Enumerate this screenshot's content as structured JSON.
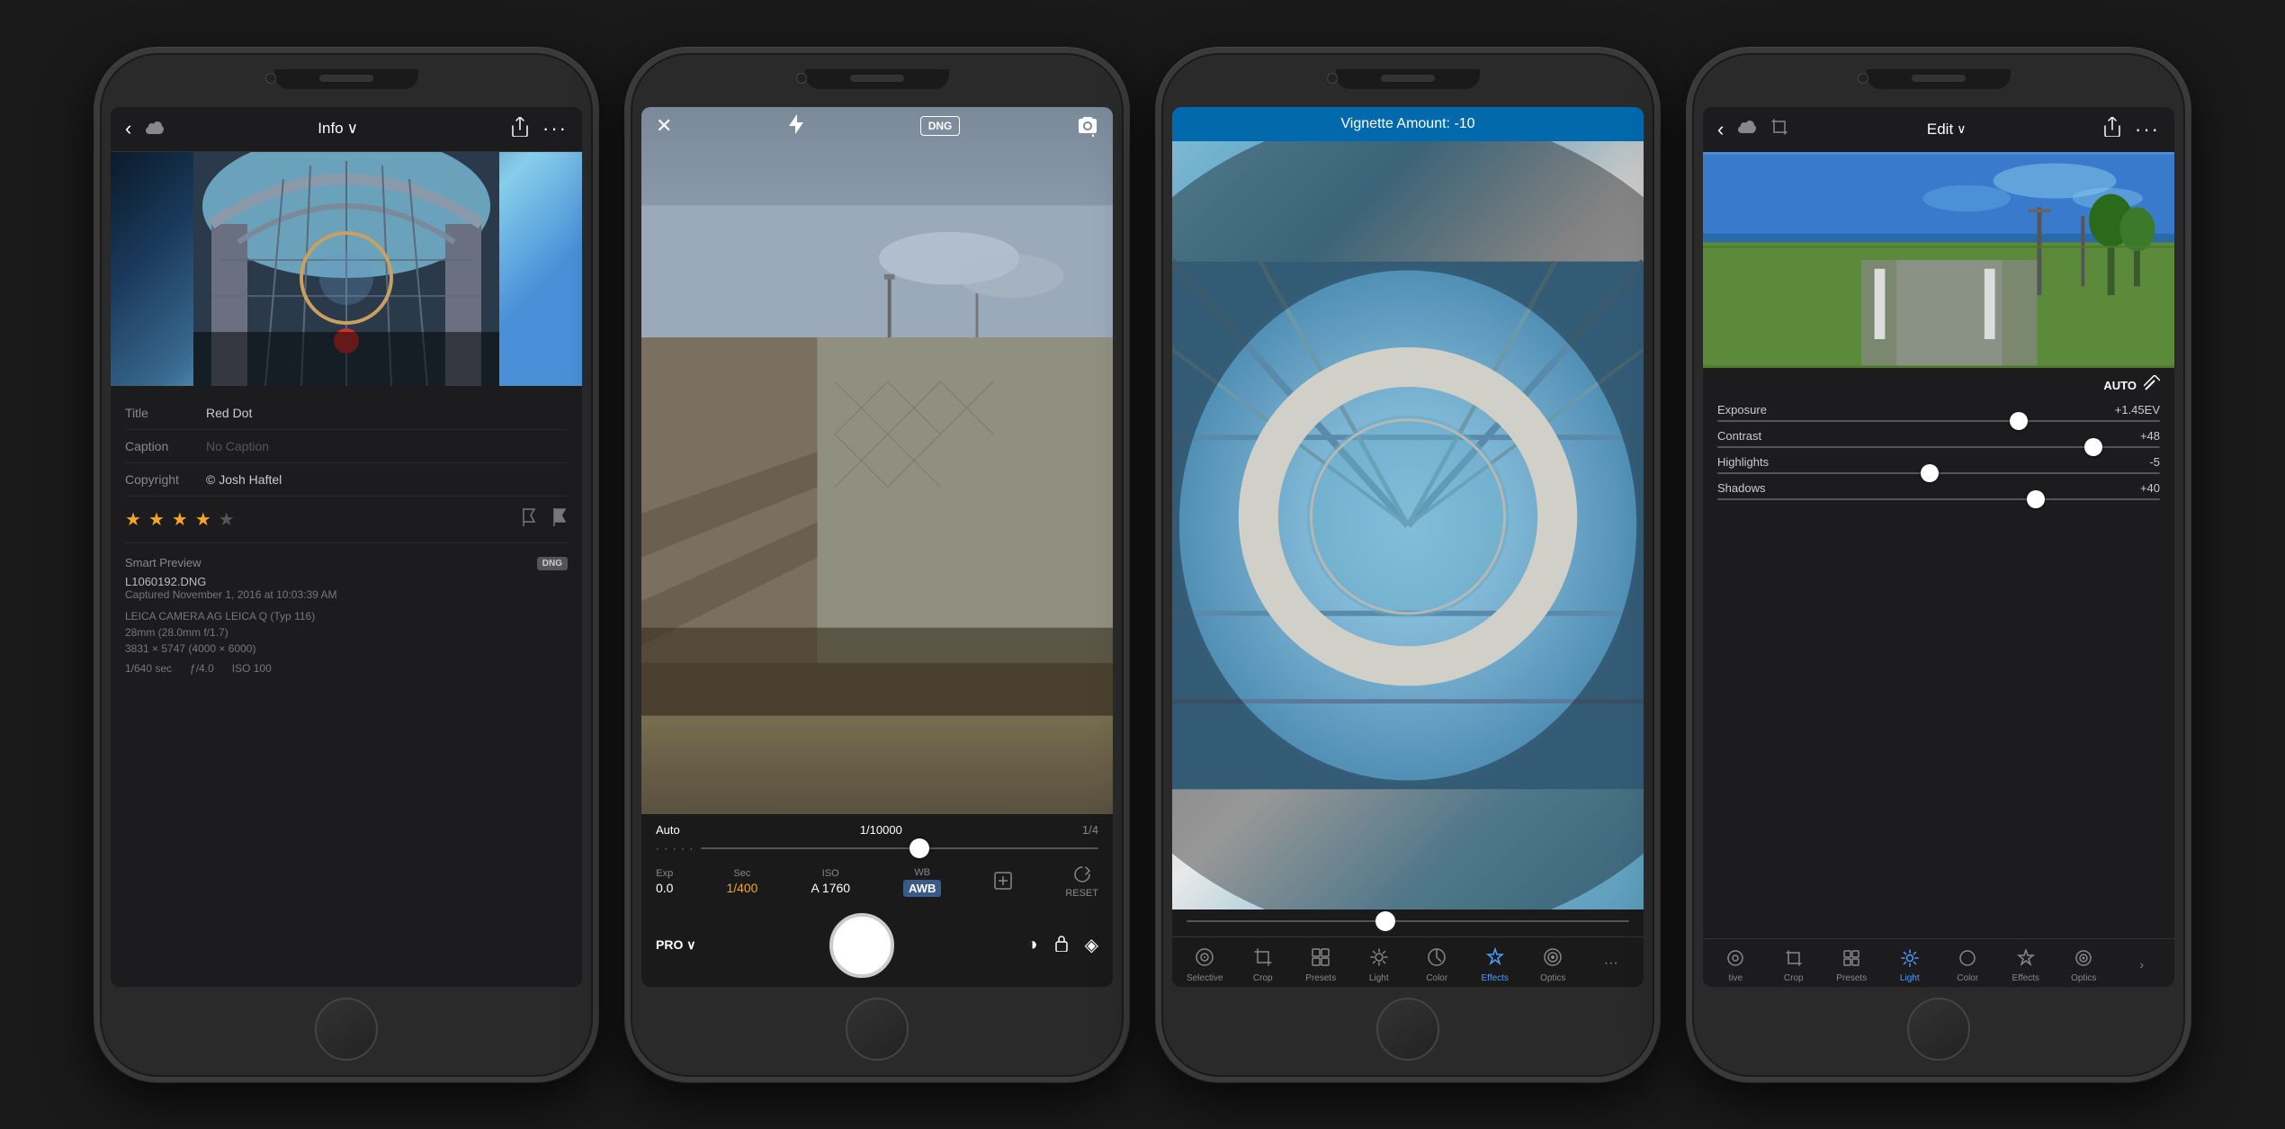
{
  "phones": [
    {
      "id": "phone1",
      "screen": "info",
      "header": {
        "back_label": "‹",
        "cloud_icon": "☁",
        "title": "Info",
        "dropdown_arrow": "∨",
        "share_icon": "⬆",
        "more_icon": "···"
      },
      "metadata": {
        "title_label": "Title",
        "title_value": "Red Dot",
        "caption_label": "Caption",
        "caption_placeholder": "No Caption",
        "copyright_label": "Copyright",
        "copyright_value": "© Josh Haftel",
        "stars": 4,
        "star_total": 5
      },
      "file_info": {
        "preview_label": "Smart Preview",
        "dng_badge": "DNG",
        "filename": "L1060192.DNG",
        "captured": "Captured November 1, 2016 at 10:03:39 AM",
        "camera": "LEICA CAMERA AG LEICA Q (Typ 116)",
        "focal": "28mm (28.0mm f/1.7)",
        "dimensions": "3831 × 5747 (4000 × 6000)",
        "shutter": "1/640 sec",
        "aperture": "ƒ/4.0",
        "iso": "ISO 100"
      }
    },
    {
      "id": "phone2",
      "screen": "camera",
      "top_bar": {
        "close_icon": "✕",
        "lightning_icon": "⚡",
        "dng_badge": "DNG",
        "flip_icon": "⟳"
      },
      "exposure": {
        "label": "Auto",
        "value": "1/10000",
        "counter": "1/4"
      },
      "controls": [
        {
          "label": "Exp",
          "value": "0.0",
          "active": false
        },
        {
          "label": "Sec",
          "value": "1/400",
          "active": true
        },
        {
          "label": "ISO",
          "value": "A 1760",
          "active": false
        },
        {
          "label": "WB",
          "value": "AWB",
          "active": false
        },
        {
          "label": "[+]",
          "value": "",
          "active": false
        },
        {
          "label": "RESET",
          "value": "",
          "active": false
        }
      ],
      "pro_label": "PRO ∨",
      "right_icons": [
        "half-moon",
        "lock",
        "leaf"
      ]
    },
    {
      "id": "phone3",
      "screen": "effects",
      "vignette_header": "Vignette Amount: -10",
      "toolbar": [
        {
          "icon": "◎",
          "label": "Selective",
          "active": false
        },
        {
          "icon": "⊡",
          "label": "Crop",
          "active": false
        },
        {
          "icon": "▦",
          "label": "Presets",
          "active": false
        },
        {
          "icon": "☀",
          "label": "Light",
          "active": false
        },
        {
          "icon": "◐",
          "label": "Color",
          "active": false
        },
        {
          "icon": "✦",
          "label": "Effects",
          "active": true
        },
        {
          "icon": "◉",
          "label": "Optics",
          "active": false
        },
        {
          "icon": "···",
          "label": "",
          "active": false
        }
      ]
    },
    {
      "id": "phone4",
      "screen": "edit_light",
      "header": {
        "back_icon": "‹",
        "cloud_icon": "☁",
        "crop_icon": "⊡",
        "title": "Edit",
        "dropdown_arrow": "∨",
        "share_icon": "⬆",
        "more_icon": "···"
      },
      "auto_btn": "AUTO",
      "sliders": [
        {
          "name": "Exposure",
          "value": "+1.45EV",
          "thumb_pct": 68
        },
        {
          "name": "Contrast",
          "value": "+48",
          "thumb_pct": 85
        },
        {
          "name": "Highlights",
          "value": "-5",
          "thumb_pct": 48
        },
        {
          "name": "Shadows",
          "value": "+40",
          "thumb_pct": 72
        }
      ],
      "toolbar": [
        {
          "icon": "◎",
          "label": "tive",
          "active": false
        },
        {
          "icon": "⊡",
          "label": "Crop",
          "active": false
        },
        {
          "icon": "▦",
          "label": "Presets",
          "active": false
        },
        {
          "icon": "☀",
          "label": "Light",
          "active": true
        },
        {
          "icon": "◐",
          "label": "Color",
          "active": false
        },
        {
          "icon": "✦",
          "label": "Effects",
          "active": false
        },
        {
          "icon": "◉",
          "label": "Optics",
          "active": false
        },
        {
          "icon": ">",
          "label": "",
          "active": false
        }
      ]
    }
  ]
}
